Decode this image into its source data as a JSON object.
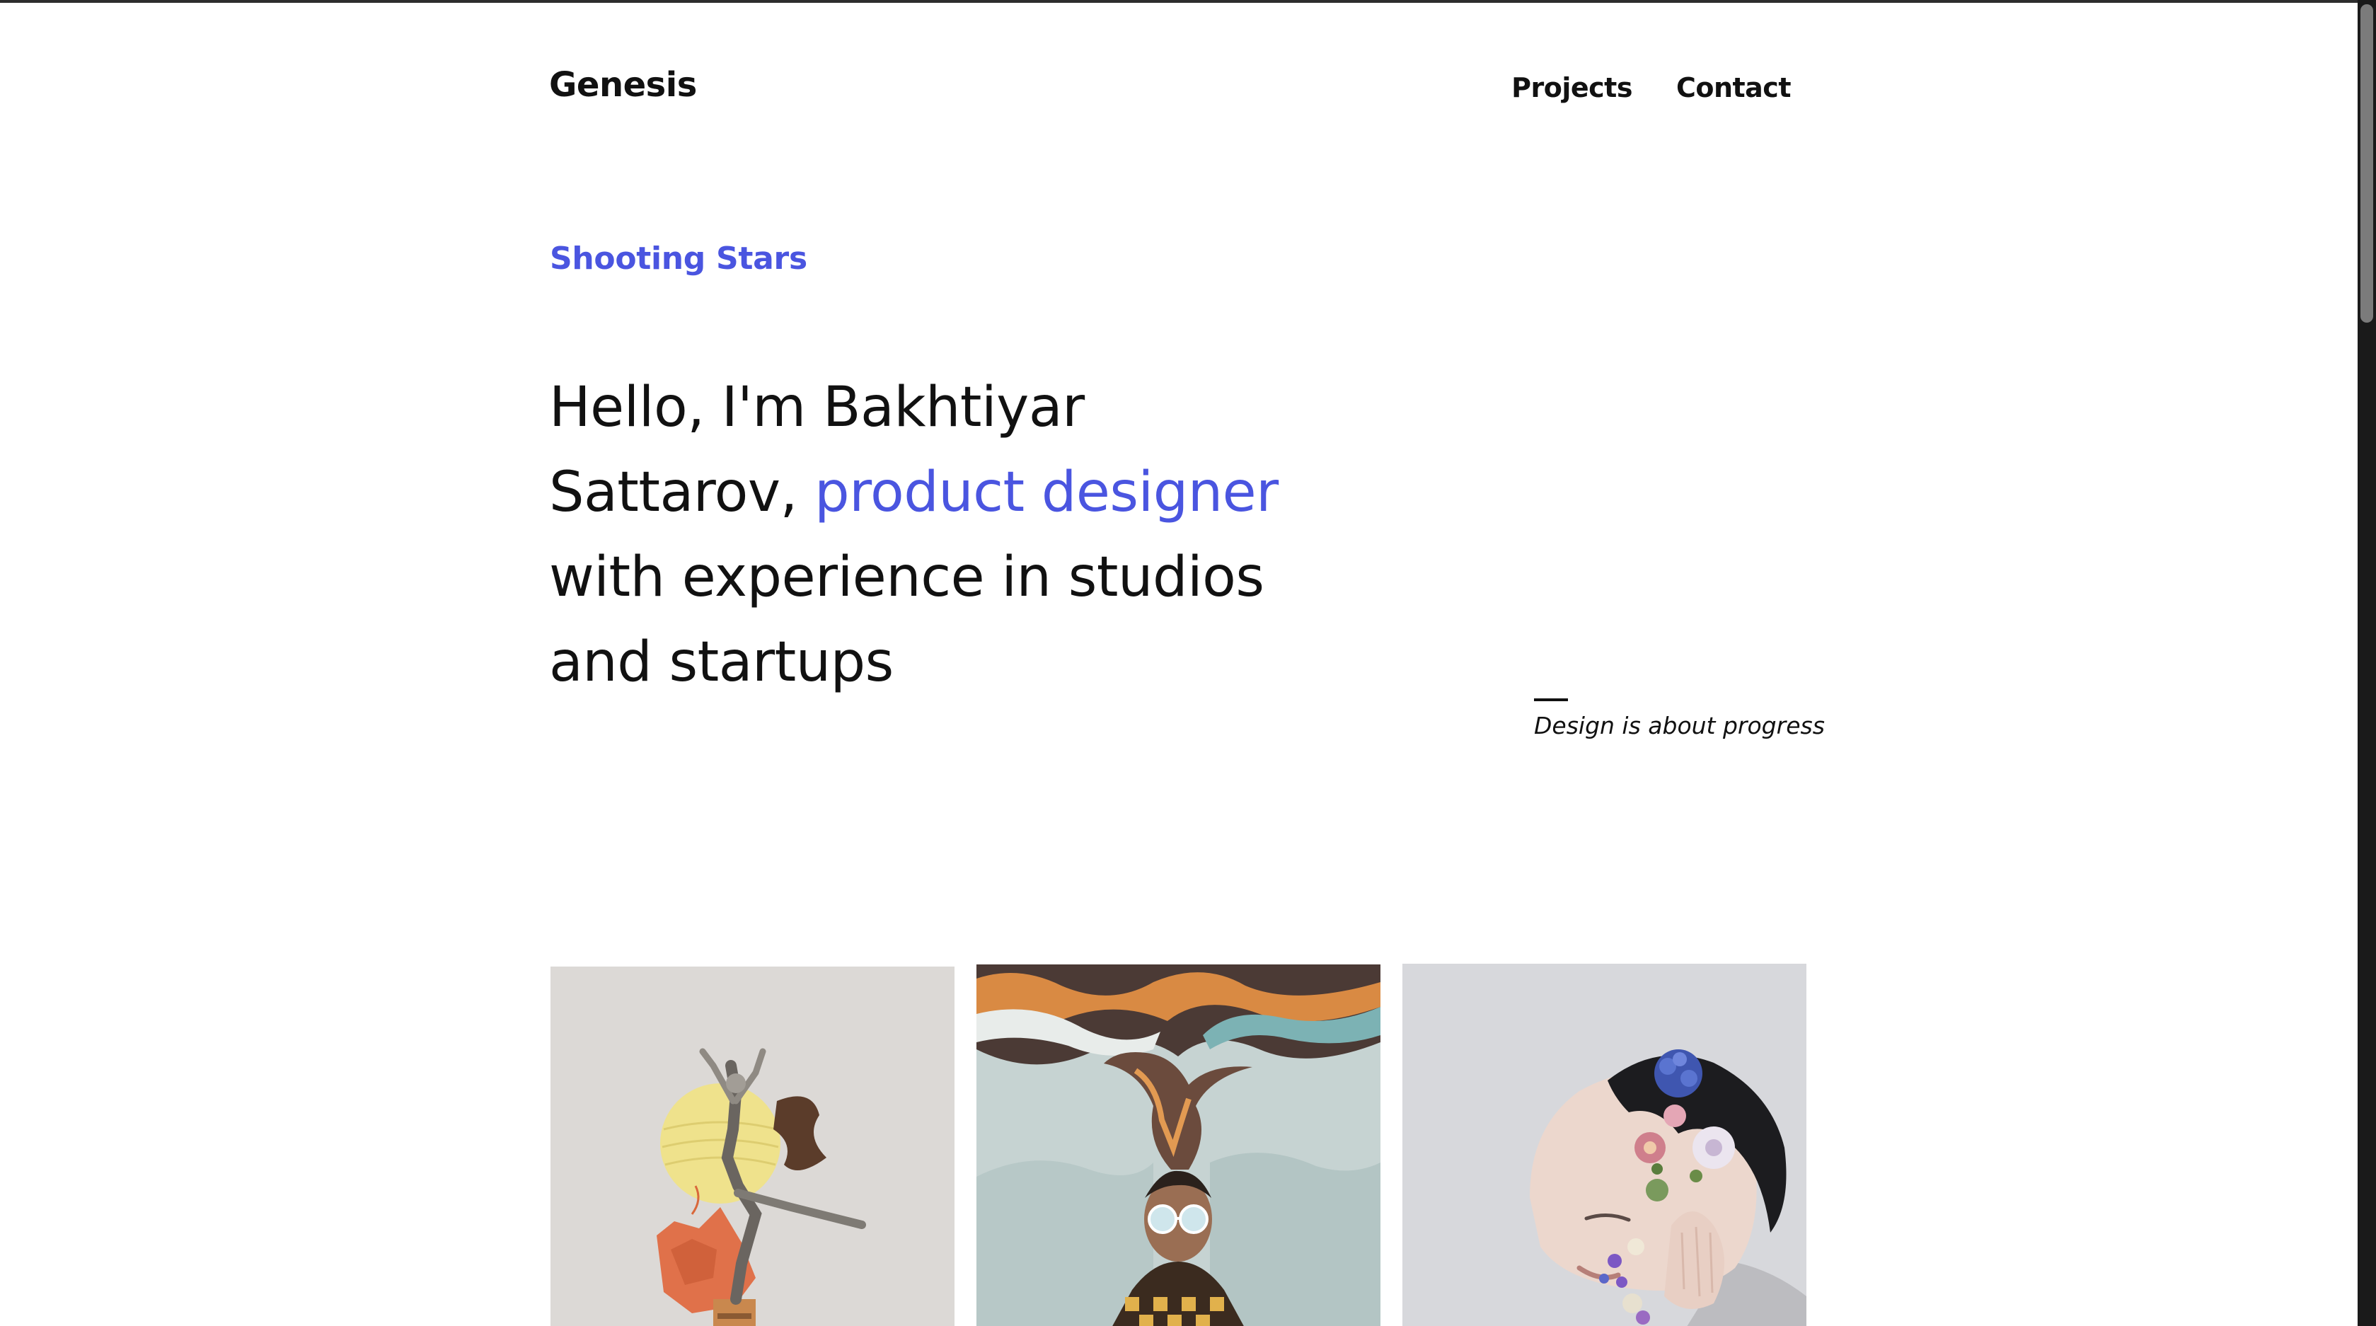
{
  "header": {
    "logo": "Genesis",
    "nav": [
      {
        "label": "Projects"
      },
      {
        "label": "Contact"
      }
    ]
  },
  "intro": {
    "tagline": "Shooting Stars",
    "hero_before": "Hello, I'm Bakhtiyar Sattarov, ",
    "hero_accent": "product designer",
    "hero_after": " with experience in studios and startups",
    "quote": "Design is about progress"
  },
  "projects": [
    {
      "icon": "dancer-collage-image"
    },
    {
      "icon": "smoke-head-illustration-image"
    },
    {
      "icon": "flower-face-portrait-image"
    }
  ],
  "colors": {
    "accent": "#4a55e0",
    "text": "#111111",
    "background": "#ffffff"
  }
}
